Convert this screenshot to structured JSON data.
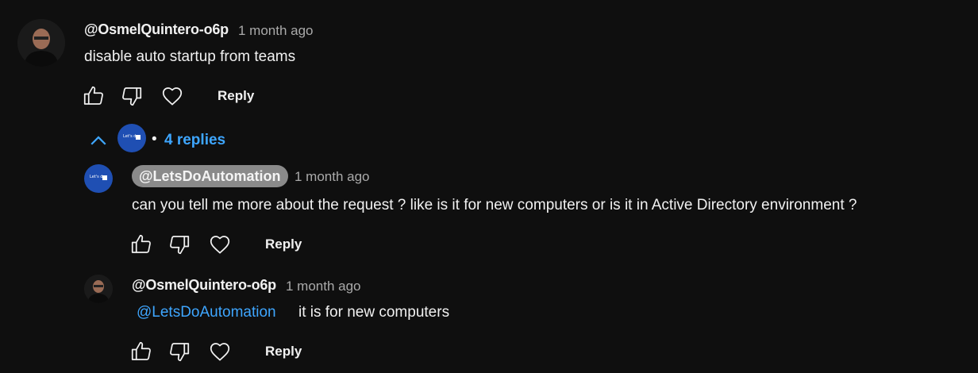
{
  "comments": [
    {
      "author": "@OsmelQuintero-o6p",
      "time": "1 month ago",
      "text": "disable auto startup from teams",
      "reply_label": "Reply"
    }
  ],
  "replies_summary": {
    "separator": "•",
    "count_label": "4 replies"
  },
  "replies": [
    {
      "author": "@LetsDoAutomation",
      "time": "1 month ago",
      "text": "can you tell me more about the request ? like is it for new computers or is it in Active Directory environment ?",
      "reply_label": "Reply",
      "avatar_text": "Let's do"
    },
    {
      "author": "@OsmelQuintero-o6p",
      "time": "1 month ago",
      "mention": "@LetsDoAutomation",
      "text": "it is for new computers",
      "reply_label": "Reply"
    }
  ],
  "colors": {
    "background": "#0f0f0f",
    "accent": "#3ea6ff",
    "brand_avatar": "#1f4fb3",
    "muted": "#aaaaaa"
  },
  "icons": [
    "like-icon",
    "dislike-icon",
    "heart-icon",
    "chevron-up-icon"
  ]
}
